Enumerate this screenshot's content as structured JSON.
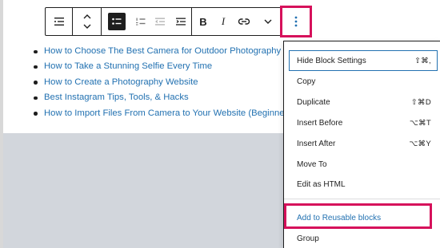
{
  "toolbar": {
    "buttons": [
      {
        "name": "block-type-list-icon",
        "label": "List"
      },
      {
        "name": "move-up-down-icon",
        "label": "Move up / Move down"
      },
      {
        "name": "unordered-list-icon",
        "label": "Unordered list"
      },
      {
        "name": "ordered-list-icon",
        "label": "Ordered list"
      },
      {
        "name": "outdent-icon",
        "label": "Outdent"
      },
      {
        "name": "indent-icon",
        "label": "Indent"
      },
      {
        "name": "bold-icon",
        "label": "B"
      },
      {
        "name": "italic-icon",
        "label": "I"
      },
      {
        "name": "link-icon",
        "label": "Link"
      },
      {
        "name": "chevron-down-icon",
        "label": "More rich text controls"
      },
      {
        "name": "more-options-icon",
        "label": "More options"
      }
    ],
    "bold_glyph": "B",
    "italic_glyph": "I"
  },
  "list": {
    "items": [
      "How to Choose The Best Camera for Outdoor Photography",
      "How to Take a Stunning Selfie Every Time",
      "How to Create a Photography Website",
      "Best Instagram Tips, Tools, & Hacks",
      "How to Import Files From Camera to Your Website (Beginner’s"
    ]
  },
  "menu": {
    "items": [
      {
        "label": "Hide Block Settings",
        "shortcut": "⇧⌘,"
      },
      {
        "label": "Copy",
        "shortcut": ""
      },
      {
        "label": "Duplicate",
        "shortcut": "⇧⌘D"
      },
      {
        "label": "Insert Before",
        "shortcut": "⌥⌘T"
      },
      {
        "label": "Insert After",
        "shortcut": "⌥⌘Y"
      },
      {
        "label": "Move To",
        "shortcut": ""
      },
      {
        "label": "Edit as HTML",
        "shortcut": ""
      },
      {
        "label": "Add to Reusable blocks",
        "shortcut": ""
      },
      {
        "label": "Group",
        "shortcut": ""
      }
    ]
  },
  "colors": {
    "highlight": "#d6115b",
    "link": "#2271b1",
    "toolbar_border": "#1e1e1e"
  }
}
